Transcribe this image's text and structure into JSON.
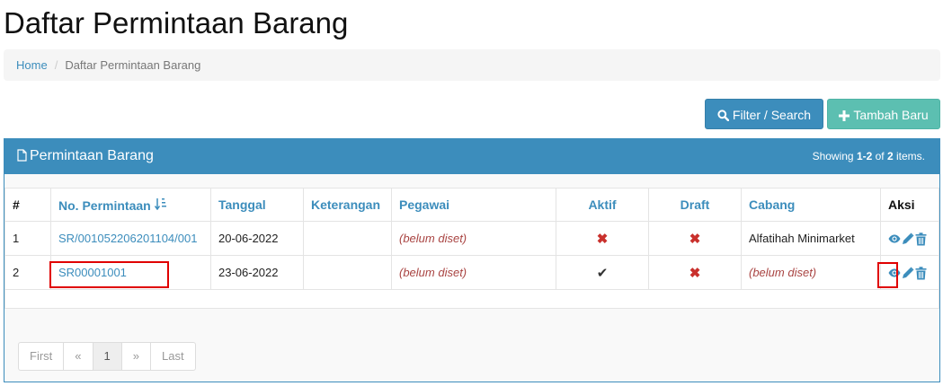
{
  "page": {
    "title": "Daftar Permintaan Barang"
  },
  "breadcrumb": {
    "home": "Home",
    "separator": "/",
    "current": "Daftar Permintaan Barang"
  },
  "toolbar": {
    "filter_label": "Filter / Search",
    "add_label": "Tambah Baru"
  },
  "panel": {
    "title": "Permintaan Barang",
    "summary_prefix": "Showing ",
    "summary_range": "1-2",
    "summary_mid": " of ",
    "summary_total": "2",
    "summary_suffix": " items."
  },
  "table": {
    "headers": {
      "num": "#",
      "no_permintaan": "No. Permintaan",
      "tanggal": "Tanggal",
      "keterangan": "Keterangan",
      "pegawai": "Pegawai",
      "aktif": "Aktif",
      "draft": "Draft",
      "cabang": "Cabang",
      "aksi": "Aksi"
    },
    "rows": [
      {
        "num": "1",
        "no_permintaan": "SR/001052206201104/001",
        "tanggal": "20-06-2022",
        "keterangan": "",
        "pegawai": "(belum diset)",
        "aktif": "✖",
        "draft": "✖",
        "cabang": "Alfatihah Minimarket"
      },
      {
        "num": "2",
        "no_permintaan": "SR00001001",
        "tanggal": "23-06-2022",
        "keterangan": "",
        "pegawai": "(belum diset)",
        "aktif": "✔",
        "draft": "✖",
        "cabang": "(belum diset)"
      }
    ]
  },
  "pagination": {
    "first": "First",
    "prev": "«",
    "current": "1",
    "next": "»",
    "last": "Last"
  },
  "colors": {
    "primary": "#3c8dbc",
    "success": "#5cbfb1",
    "danger": "#c9302c",
    "highlight": "#e00000"
  }
}
